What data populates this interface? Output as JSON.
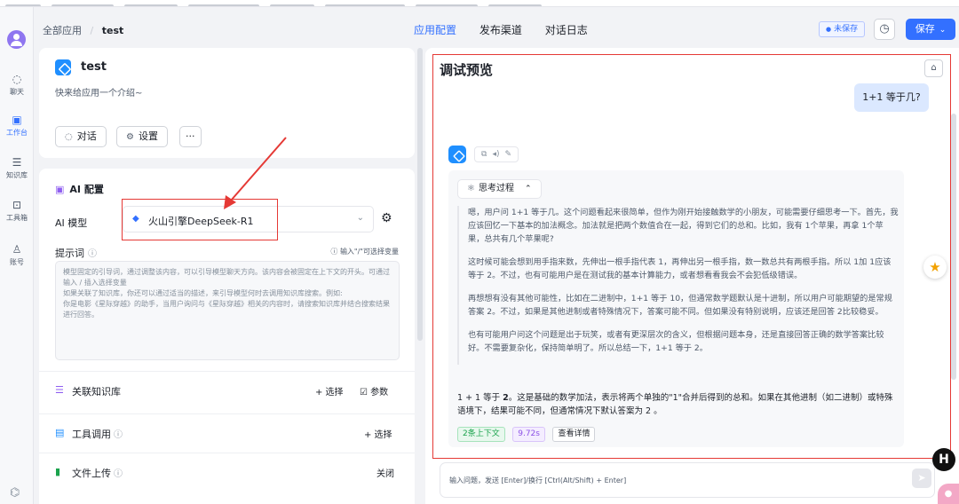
{
  "rail": {
    "items": [
      {
        "label": "聊天",
        "icon": "chat-icon"
      },
      {
        "label": "工作台",
        "icon": "robot-icon"
      },
      {
        "label": "知识库",
        "icon": "database-icon"
      },
      {
        "label": "工具箱",
        "icon": "toolbox-icon"
      },
      {
        "label": "账号",
        "icon": "user-icon"
      }
    ],
    "active": "工作台"
  },
  "header": {
    "breadcrumb": [
      "全部应用",
      "test"
    ],
    "tabs": [
      "应用配置",
      "发布渠道",
      "对话日志"
    ],
    "active_tab": "应用配置",
    "unsaved_label": "未保存",
    "save_label": "保存"
  },
  "app": {
    "name": "test",
    "description": "快来给应用一个介绍~",
    "chat_button": "对话",
    "settings_button": "设置",
    "more_button": "···"
  },
  "ai_config": {
    "title": "AI 配置",
    "model_label": "AI 模型",
    "model_value": "火山引擎DeepSeek-R1",
    "prompt_label": "提示词",
    "prompt_hint": "输入\"/\"可选择变量",
    "prompt_placeholder": "模型固定的引导词，通过调整该内容，可以引导模型聊天方向。该内容会被固定在上下文的开头。可通过输入 / 插入选择变量\n如果关联了知识库，你还可以通过适当的描述，来引导模型何时去调用知识库搜索。例如:\n你是电影《星际穿越》的助手，当用户询问与《星际穿越》相关的内容时，请搜索知识库并结合搜索结果进行回答。"
  },
  "rows": {
    "knowledge": {
      "label": "关联知识库",
      "select": "+ 选择",
      "params": "参数"
    },
    "tools": {
      "label": "工具调用",
      "select": "+ 选择"
    },
    "file_upload": {
      "label": "文件上传",
      "status": "关闭"
    }
  },
  "preview": {
    "title": "调试预览",
    "user_message": "1+1 等于几?",
    "think_label": "思考过程",
    "think_paragraphs": [
      "嗯，用户问 1+1 等于几。这个问题看起来很简单，但作为刚开始接触数学的小朋友，可能需要仔细思考一下。首先，我应该回忆一下基本的加法概念。加法就是把两个数值合在一起，得到它们的总和。比如，我有 1个苹果，再拿 1个苹果，总共有几个苹果呢?",
      "这时候可能会想到用手指来数，先伸出一根手指代表 1，再伸出另一根手指，数一数总共有两根手指。所以 1加 1应该等于 2。不过，也有可能用户是在测试我的基本计算能力，或者想看看我会不会犯低级错误。",
      "再想想有没有其他可能性，比如在二进制中，1+1 等于 10，但通常数学题默认是十进制，所以用户可能期望的是常规答案 2。不过，如果是其他进制或者特殊情况下，答案可能不同。但如果没有特别说明，应该还是回答 2比较稳妥。",
      "也有可能用户问这个问题是出于玩笑，或者有更深层次的含义，但根据问题本身，还是直接回答正确的数学答案比较好。不需要复杂化，保持简单明了。所以总结一下，1+1 等于 2。"
    ],
    "final_answer_prefix": "1 + 1 等于 ",
    "final_answer_bold": "2",
    "final_answer_suffix": "。这是基础的数学加法，表示将两个单独的\"1\"合并后得到的总和。如果在其他进制（如二进制）或特殊语境下，结果可能不同，但通常情况下默认答案为 2 。",
    "badges": {
      "context": "2条上下文",
      "time": "9.72s",
      "detail": "查看详情"
    },
    "input_placeholder": "输入问题，发送 [Enter]/换行 [Ctrl(Alt/Shift) + Enter]"
  },
  "colors": {
    "accent": "#3370ff",
    "annotation": "#e53935"
  }
}
